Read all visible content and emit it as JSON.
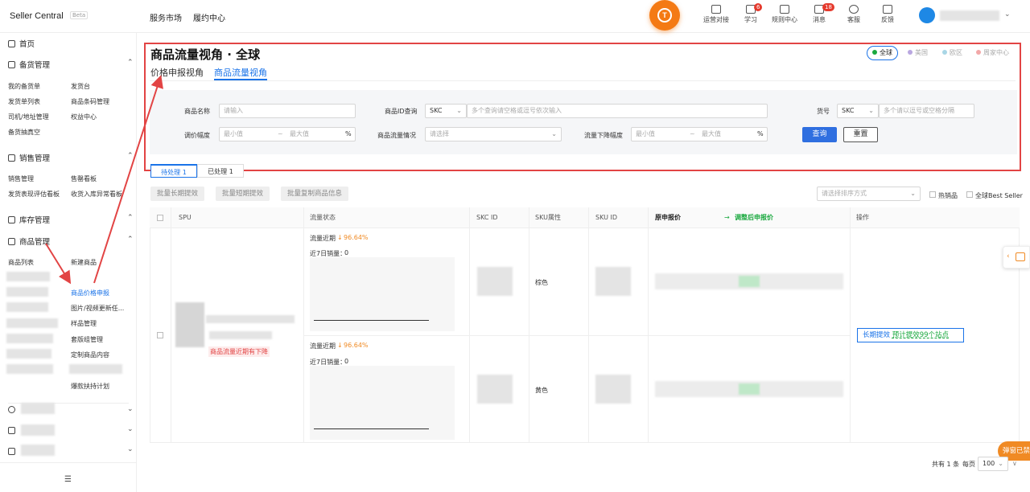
{
  "topbar": {
    "brand": "Seller Central",
    "beta": "Beta",
    "nav": [
      "服务市场",
      "履约中心"
    ],
    "logo_letter": "T",
    "tools": [
      {
        "label": "运营对接",
        "badge": ""
      },
      {
        "label": "学习",
        "badge": "6"
      },
      {
        "label": "规则中心",
        "badge": ""
      },
      {
        "label": "消息",
        "badge": "18"
      },
      {
        "label": "客服",
        "badge": ""
      },
      {
        "label": "反馈",
        "badge": ""
      }
    ]
  },
  "sidebar": {
    "home": "首页",
    "groups": [
      {
        "title": "备货管理",
        "items": [
          "我的备货单",
          "发货台",
          "发货单列表",
          "商品条码管理",
          "司机/地址管理",
          "权益中心",
          "备货抽真空"
        ]
      },
      {
        "title": "销售管理",
        "items": [
          "销售管理",
          "售罄看板",
          "发货表现评估看板",
          "收货入库异常看板"
        ]
      },
      {
        "title": "库存管理",
        "items": []
      },
      {
        "title": "商品管理",
        "items": [
          "商品列表",
          "新建商品",
          "商品价格申报",
          "图片/视频更新任...",
          "样品管理",
          "套版组管理",
          "定制商品内容",
          "爆款扶持计划"
        ]
      }
    ]
  },
  "page": {
    "title": "商品流量视角 · 全球",
    "tabs": [
      "价格申报视角",
      "商品流量视角"
    ],
    "regions": [
      "全球",
      "美国",
      "欧区",
      "周家中心"
    ],
    "filters": {
      "name_label": "商品名称",
      "name_placeholder": "请输入",
      "id_label": "商品ID查询",
      "id_select": "SKC",
      "id_placeholder": "多个查询请空格或逗号依次输入",
      "code_label": "货号",
      "code_select": "SKC",
      "code_placeholder": "多个请以逗号或空格分隔",
      "adjust_label": "调价幅度",
      "min_placeholder": "最小值",
      "tilde": "~",
      "max_placeholder": "最大值",
      "percent": "%",
      "flow_label": "商品流量情况",
      "flow_placeholder": "请选择",
      "drop_label": "流量下降幅度",
      "query": "查询",
      "reset": "重置"
    },
    "subtabs": [
      "待处理 1",
      "已处理 1"
    ],
    "batch_buttons": [
      "批量长期提效",
      "批量短期提效",
      "批量复制商品信息"
    ],
    "sort_placeholder": "请选择排序方式",
    "hot_label": "热销品",
    "best_label": "全球Best Seller",
    "columns": [
      "SPU",
      "流量状态",
      "SKC ID",
      "SKU属性",
      "SKU ID",
      "原申报价",
      "调整后申报价",
      "操作"
    ],
    "adjust_arrow": "→",
    "row": {
      "tag": "商品流量近期有下降",
      "trend_arrow": "↓",
      "skus": [
        {
          "flow_label": "流量近期",
          "flow_value": "96.64%",
          "sales_label": "近7日销量：",
          "sales_value": "0",
          "attr": "棕色"
        },
        {
          "flow_label": "流量近期",
          "flow_value": "96.64%",
          "sales_label": "近7日销量：",
          "sales_value": "0",
          "attr": "黄色"
        }
      ],
      "action_label": "长期提效",
      "action_highlight": "预计提效99个站点"
    },
    "pager": {
      "total": "共有 1 条",
      "per_page_label": "每页",
      "per_page": "100"
    }
  },
  "colors": {
    "accent": "#1a73e8",
    "annotation": "#e24444",
    "brand_orange": "#f47a14",
    "green": "#19a83e"
  }
}
